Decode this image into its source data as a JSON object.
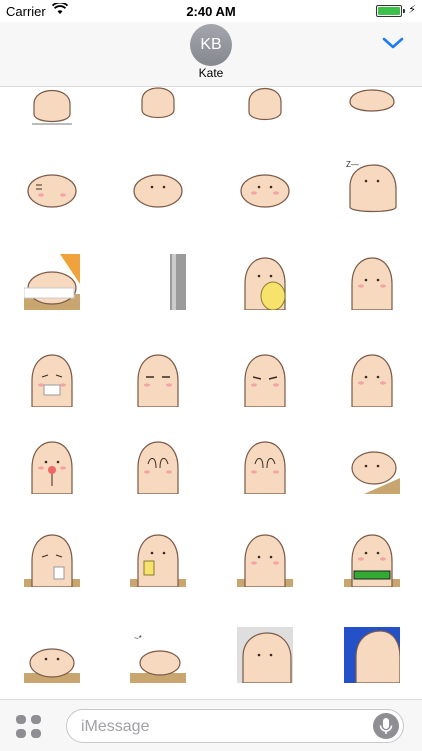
{
  "status_bar": {
    "carrier": "Carrier",
    "time": "2:40 AM",
    "battery_level": 1.0,
    "charging": true
  },
  "header": {
    "avatar_initials": "KB",
    "contact_name": "Kate",
    "collapse_icon": "chevron-down-icon",
    "accent_color": "#1e7af5"
  },
  "stickers": [
    {
      "name": "potato-pose-1",
      "row": 0,
      "col": 0
    },
    {
      "name": "potato-pose-2",
      "row": 0,
      "col": 1
    },
    {
      "name": "potato-pose-3",
      "row": 0,
      "col": 2
    },
    {
      "name": "potato-pose-4",
      "row": 0,
      "col": 3
    },
    {
      "name": "potato-sleeping-face",
      "row": 1,
      "col": 0
    },
    {
      "name": "potato-lying-side",
      "row": 1,
      "col": 1
    },
    {
      "name": "potato-lying-blush",
      "row": 1,
      "col": 2
    },
    {
      "name": "potato-snoring-zzz",
      "row": 1,
      "col": 3
    },
    {
      "name": "potato-in-bed-orange-blanket",
      "row": 2,
      "col": 0
    },
    {
      "name": "potato-behind-grey-wall",
      "row": 2,
      "col": 1
    },
    {
      "name": "potato-with-yellow-chick",
      "row": 2,
      "col": 2
    },
    {
      "name": "potato-sideways-look",
      "row": 2,
      "col": 3
    },
    {
      "name": "potato-crying",
      "row": 3,
      "col": 0
    },
    {
      "name": "potato-annoyed",
      "row": 3,
      "col": 1
    },
    {
      "name": "potato-frowning",
      "row": 3,
      "col": 2
    },
    {
      "name": "potato-neutral",
      "row": 3,
      "col": 3
    },
    {
      "name": "potato-with-lollipop",
      "row": 4,
      "col": 0
    },
    {
      "name": "potato-covering-face",
      "row": 4,
      "col": 1
    },
    {
      "name": "potato-hands-on-face",
      "row": 4,
      "col": 2
    },
    {
      "name": "potato-lying-on-table",
      "row": 4,
      "col": 3
    },
    {
      "name": "potato-at-table-cup",
      "row": 5,
      "col": 0
    },
    {
      "name": "potato-drinking-cup",
      "row": 5,
      "col": 1
    },
    {
      "name": "potato-at-desk-blush",
      "row": 5,
      "col": 2
    },
    {
      "name": "potato-eating-sushi",
      "row": 5,
      "col": 3
    },
    {
      "name": "potato-lying-flat",
      "row": 6,
      "col": 0
    },
    {
      "name": "potato-flat-tired",
      "row": 6,
      "col": 1
    },
    {
      "name": "potato-spotlight-dark",
      "row": 6,
      "col": 2
    },
    {
      "name": "potato-blue-night",
      "row": 6,
      "col": 3
    }
  ],
  "bottom_bar": {
    "apps_icon": "app-drawer-icon",
    "input_placeholder": "iMessage",
    "mic_icon": "microphone-icon"
  },
  "colors": {
    "potato_fill": "#f7d9bf",
    "potato_outline": "#7a5a48",
    "blush": "#f3a4a4",
    "table": "#c9a56f",
    "grey_wall": "#9b9b9b",
    "orange_blanket": "#f0a33a",
    "chick_yellow": "#f7e26b",
    "night_blue": "#2450c8"
  }
}
